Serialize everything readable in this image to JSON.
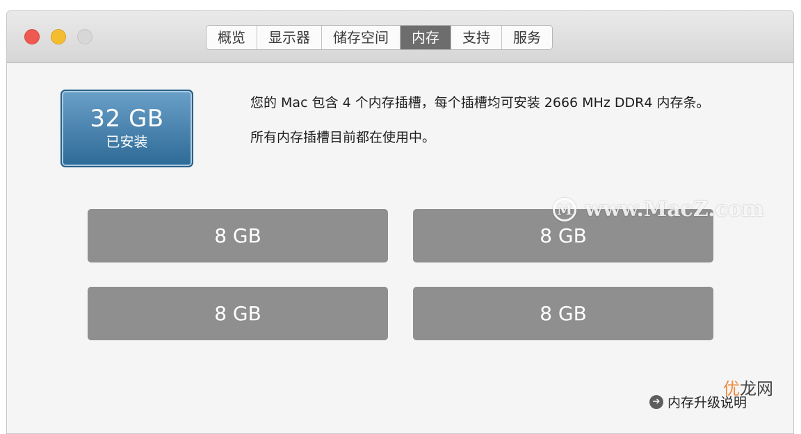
{
  "window": {
    "traffic_lights": {
      "close_color": "#ee5a52",
      "minimize_color": "#f4bc2f",
      "zoom_color": "#d7d7d7"
    },
    "tabs": [
      {
        "label": "概览"
      },
      {
        "label": "显示器"
      },
      {
        "label": "储存空间"
      },
      {
        "label": "内存",
        "active": true
      },
      {
        "label": "支持"
      },
      {
        "label": "服务"
      }
    ]
  },
  "memory": {
    "installed_size": "32 GB",
    "installed_label": "已安装",
    "description_line1": "您的 Mac 包含 4 个内存插槽，每个插槽均可安装 2666 MHz DDR4 内存条。",
    "description_line2": "所有内存插槽目前都在使用中。",
    "slots": [
      {
        "label": "8 GB"
      },
      {
        "label": "8 GB"
      },
      {
        "label": "8 GB"
      },
      {
        "label": "8 GB"
      }
    ],
    "upgrade_link": "内存升级说明",
    "upgrade_icon": "arrow-right-circle-icon"
  },
  "overlays": {
    "watermark_text": "www.MacZ.com",
    "watermark_logo": "M",
    "corner_mark_accent": "优",
    "corner_mark_rest": "龙网"
  },
  "colors": {
    "accent_blue": "#2d6a96",
    "slot_gray": "#8f8f8f",
    "active_tab": "#6d6d6d"
  }
}
